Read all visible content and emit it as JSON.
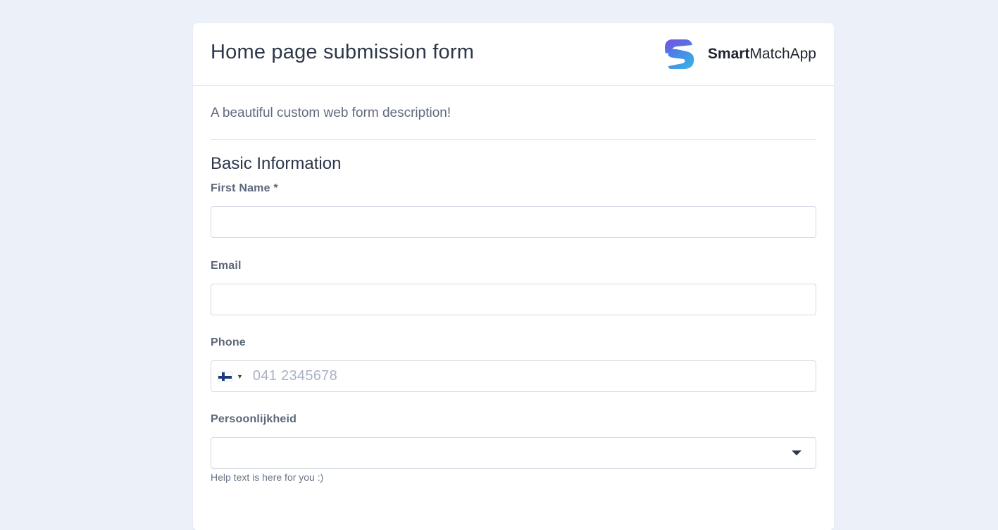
{
  "form": {
    "title": "Home page submission form",
    "description": "A beautiful custom web form description!"
  },
  "brand": {
    "name_bold": "Smart",
    "name_rest": "MatchApp",
    "logo_icon": "smartmatchapp-s-logo-icon",
    "logo_colors": [
      "#6a4fe0",
      "#3aa7e6"
    ]
  },
  "section": {
    "title": "Basic Information"
  },
  "fields": {
    "first_name": {
      "label": "First Name *",
      "value": "",
      "placeholder": ""
    },
    "email": {
      "label": "Email",
      "value": "",
      "placeholder": ""
    },
    "phone": {
      "label": "Phone",
      "placeholder": "041 2345678",
      "country": "FI",
      "flag_icon": "finland-flag-icon"
    },
    "personality": {
      "label": "Persoonlijkheid",
      "selected": "",
      "help": "Help text is here for you :)"
    }
  },
  "colors": {
    "background": "#ecf0f8",
    "card": "#ffffff",
    "border": "#d4d9e2"
  }
}
